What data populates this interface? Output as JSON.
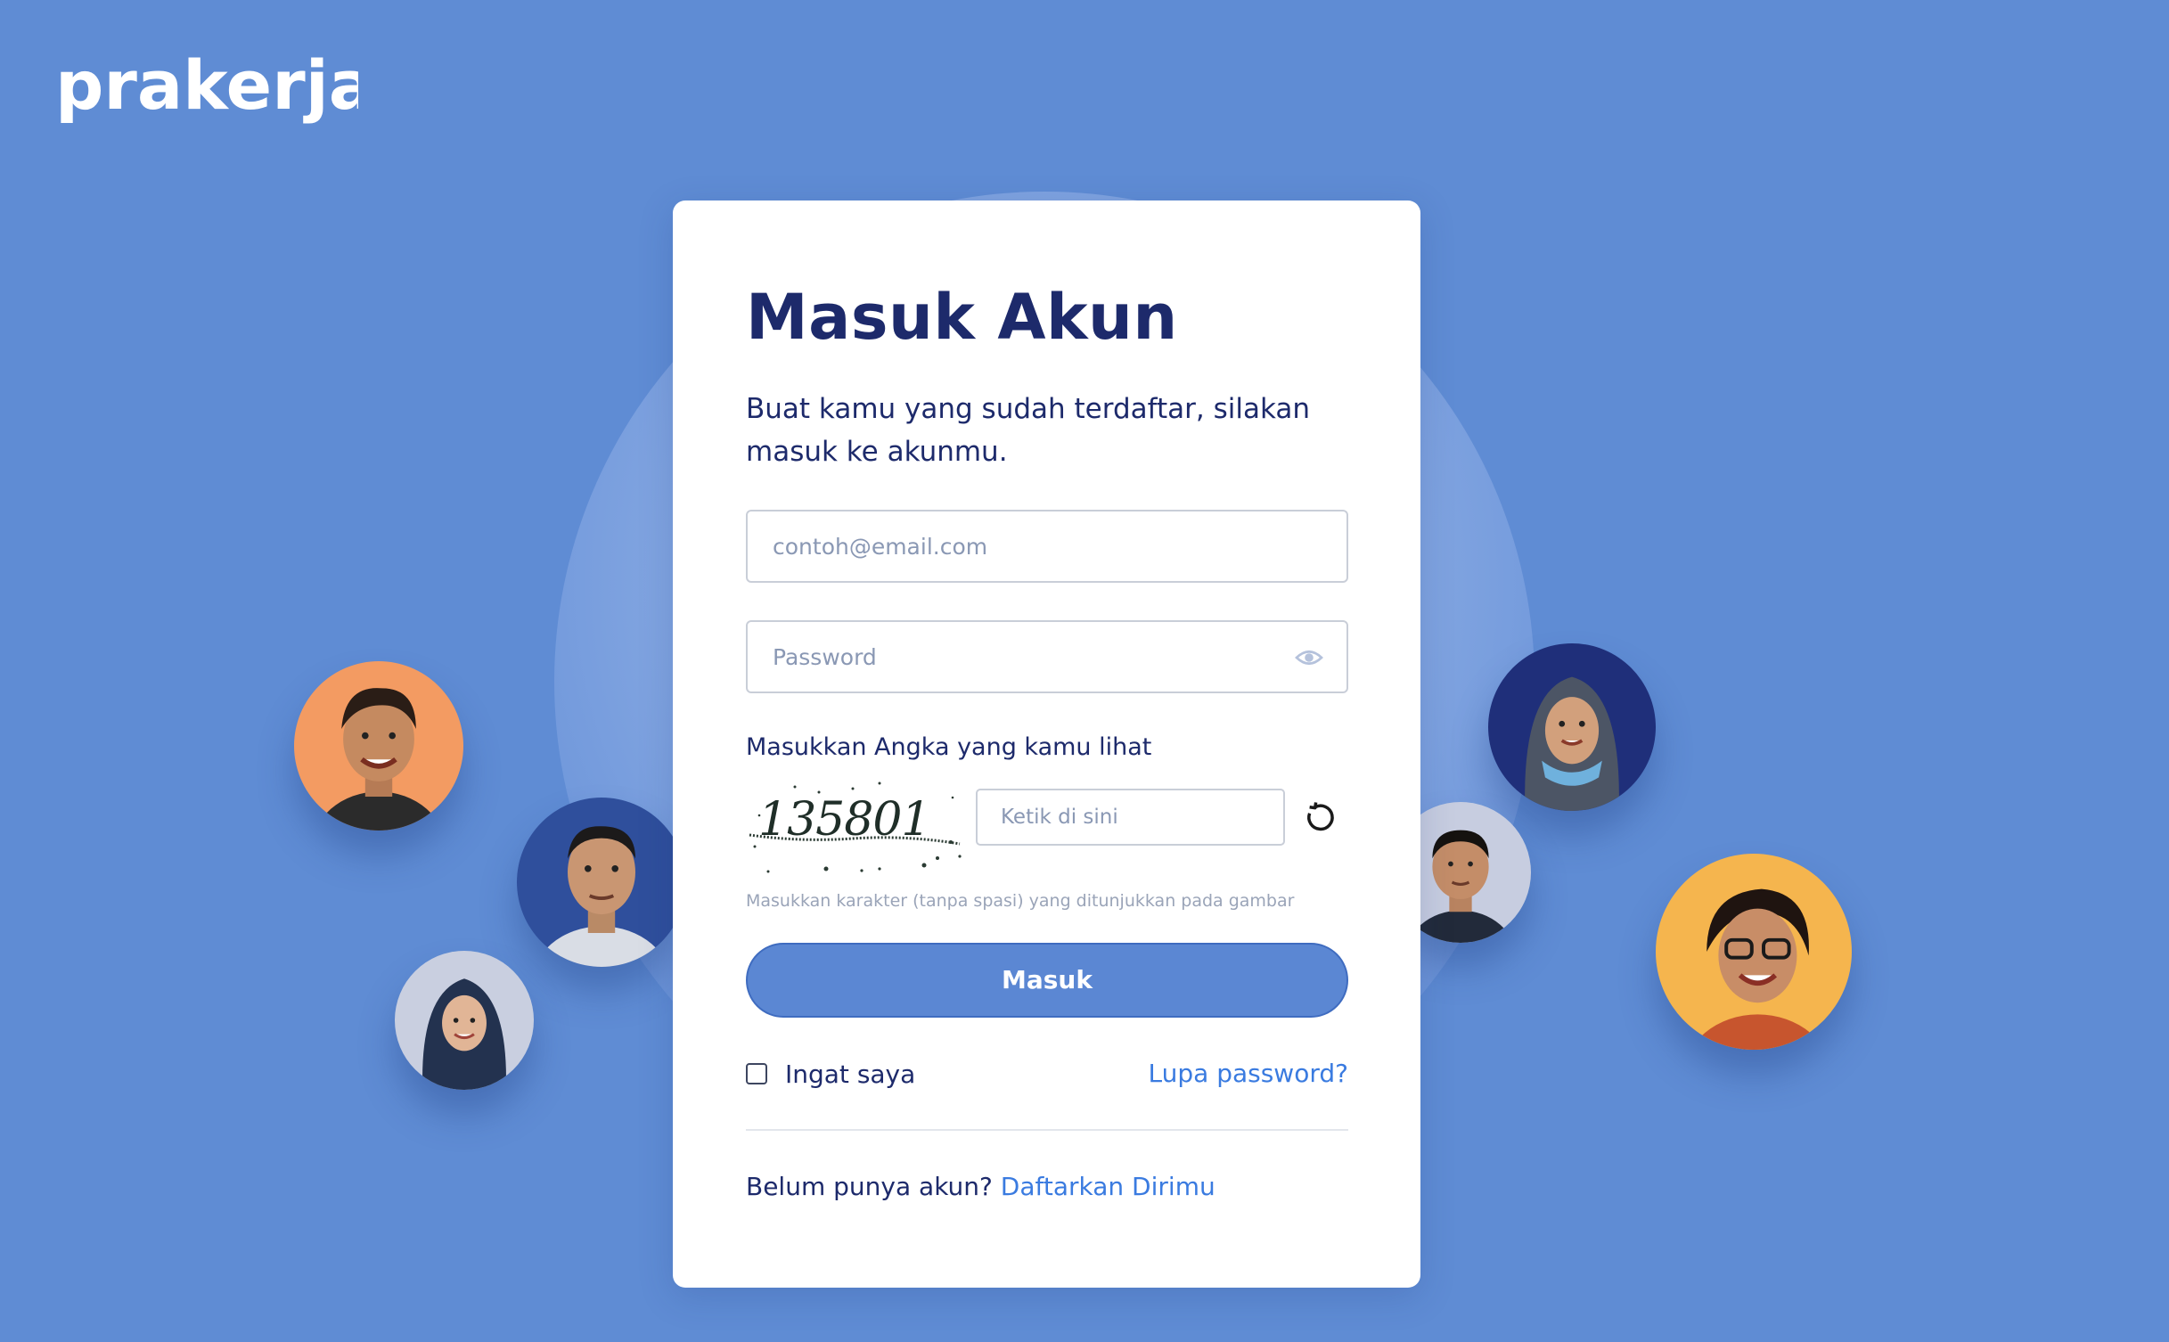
{
  "brand": {
    "logo_text": "prakerja",
    "background_color": "#5f8cd4",
    "accent_color": "#3a7be0",
    "title_color": "#1d2a6b"
  },
  "login": {
    "title": "Masuk Akun",
    "subtitle": "Buat kamu yang sudah terdaftar, silakan masuk ke akunmu.",
    "email_placeholder": "contoh@email.com",
    "email_value": "",
    "password_placeholder": "Password",
    "password_value": "",
    "password_toggle_icon": "eye-icon"
  },
  "captcha": {
    "label": "Masukkan Angka yang kamu lihat",
    "image_text": "135801",
    "input_placeholder": "Ketik di sini",
    "input_value": "",
    "refresh_icon": "refresh-icon",
    "hint": "Masukkan karakter (tanpa spasi) yang ditunjukkan pada gambar"
  },
  "actions": {
    "submit_label": "Masuk",
    "remember_label": "Ingat saya",
    "remember_checked": false,
    "forgot_label": "Lupa password?",
    "register_prompt": "Belum punya akun?",
    "register_link": "Daftarkan Dirimu"
  },
  "avatars": [
    {
      "name": "avatar-man-orange",
      "bg": "#f39b62"
    },
    {
      "name": "avatar-man-blue",
      "bg": "#2f4f9c"
    },
    {
      "name": "avatar-woman-hijab-grey",
      "bg": "#c9cfe0"
    },
    {
      "name": "avatar-woman-hijab-navy",
      "bg": "#1f2f7a"
    },
    {
      "name": "avatar-man-grey",
      "bg": "#c7cde0"
    },
    {
      "name": "avatar-woman-glasses-yellow",
      "bg": "#f5b54e"
    }
  ]
}
